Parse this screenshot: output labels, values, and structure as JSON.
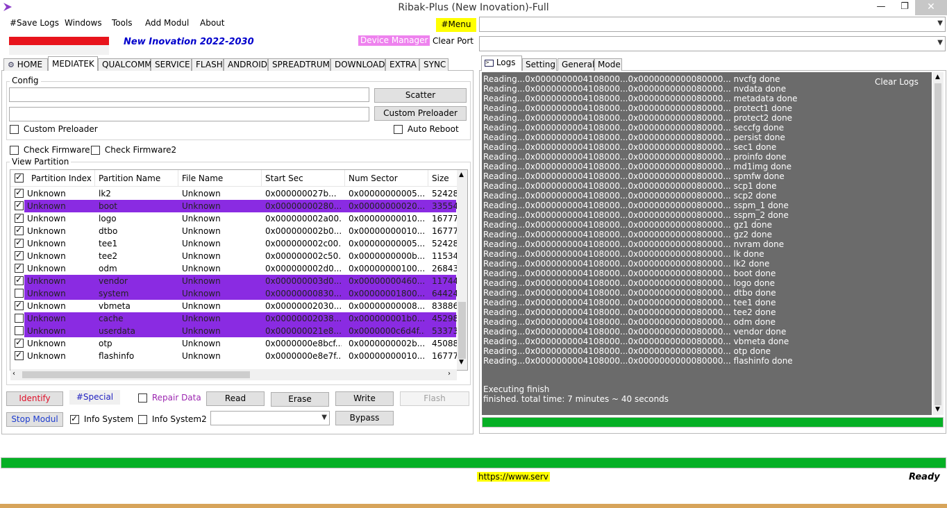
{
  "window": {
    "title": "Ribak-Plus (New Inovation)-Full",
    "controls": {
      "minimize": "—",
      "maximize": "❐",
      "close": "✕"
    }
  },
  "menu": {
    "items": [
      "#Save Logs",
      "Windows",
      "Tools",
      "Add Modul",
      "About"
    ],
    "menu_button": "#Menu"
  },
  "header": {
    "subtitle": "New Inovation 2022-2030",
    "device_manager": "Device Manager",
    "clear_port": "Clear Port",
    "brand_color": "#0000cc"
  },
  "left_tabs": [
    "HOME",
    "MEDIATEK",
    "QUALCOMM",
    "SERVICE",
    "FLASH",
    "ANDROID",
    "SPREADTRUM",
    "DOWNLOAD",
    "EXTRA",
    "SYNC"
  ],
  "config": {
    "label": "Config",
    "scatter_button": "Scatter",
    "custom_preloader_button": "Custom Preloader",
    "custom_preloader_check": "Custom Preloader",
    "auto_reboot": "Auto Reboot",
    "scatter_value": "",
    "preloader_value": ""
  },
  "checks": {
    "check_firmware": "Check Firmware",
    "check_firmware2": "Check Firmware2"
  },
  "partition": {
    "label": "View Partition",
    "columns": [
      "Partition Index",
      "Partition Name",
      "File Name",
      "Start Sec",
      "Num Sector",
      "Size"
    ],
    "rows": [
      {
        "checked": true,
        "selected": false,
        "index": "Unknown",
        "name": "lk2",
        "file": "Unknown",
        "start": "0x000000027b...",
        "num": "0x00000000005...",
        "size": "52428"
      },
      {
        "checked": true,
        "selected": true,
        "index": "Unknown",
        "name": "boot",
        "file": "Unknown",
        "start": "0x00000000280...",
        "num": "0x00000000020...",
        "size": "33554"
      },
      {
        "checked": true,
        "selected": false,
        "index": "Unknown",
        "name": "logo",
        "file": "Unknown",
        "start": "0x000000002a00...",
        "num": "0x00000000010...",
        "size": "16777"
      },
      {
        "checked": true,
        "selected": false,
        "index": "Unknown",
        "name": "dtbo",
        "file": "Unknown",
        "start": "0x000000002b0...",
        "num": "0x00000000010...",
        "size": "16777"
      },
      {
        "checked": true,
        "selected": false,
        "index": "Unknown",
        "name": "tee1",
        "file": "Unknown",
        "start": "0x000000002c00...",
        "num": "0x00000000005...",
        "size": "52428"
      },
      {
        "checked": true,
        "selected": false,
        "index": "Unknown",
        "name": "tee2",
        "file": "Unknown",
        "start": "0x000000002c50...",
        "num": "0x0000000000b...",
        "size": "11534"
      },
      {
        "checked": true,
        "selected": false,
        "index": "Unknown",
        "name": "odm",
        "file": "Unknown",
        "start": "0x000000002d0...",
        "num": "0x00000000100...",
        "size": "26843"
      },
      {
        "checked": true,
        "selected": true,
        "index": "Unknown",
        "name": "vendor",
        "file": "Unknown",
        "start": "0x000000003d0...",
        "num": "0x00000000460...",
        "size": "11744"
      },
      {
        "checked": false,
        "selected": true,
        "index": "Unknown",
        "name": "system",
        "file": "Unknown",
        "start": "0x00000000830...",
        "num": "0x00000001800...",
        "size": "64424"
      },
      {
        "checked": true,
        "selected": false,
        "index": "Unknown",
        "name": "vbmeta",
        "file": "Unknown",
        "start": "0x00000002030...",
        "num": "0x00000000008...",
        "size": "83886"
      },
      {
        "checked": false,
        "selected": true,
        "index": "Unknown",
        "name": "cache",
        "file": "Unknown",
        "start": "0x00000002038...",
        "num": "0x000000001b0...",
        "size": "45298"
      },
      {
        "checked": false,
        "selected": true,
        "index": "Unknown",
        "name": "userdata",
        "file": "Unknown",
        "start": "0x000000021e8...",
        "num": "0x0000000c6d4f...",
        "size": "53373"
      },
      {
        "checked": true,
        "selected": false,
        "index": "Unknown",
        "name": "otp",
        "file": "Unknown",
        "start": "0x0000000e8bcf...",
        "num": "0x0000000002b...",
        "size": "45088"
      },
      {
        "checked": true,
        "selected": false,
        "index": "Unknown",
        "name": "flashinfo",
        "file": "Unknown",
        "start": "0x0000000e8e7f...",
        "num": "0x00000000010...",
        "size": "16777"
      }
    ]
  },
  "actions": {
    "identify": "Identify",
    "special": "#Special",
    "repair_data": "Repair Data",
    "read": "Read",
    "erase": "Erase",
    "write": "Write",
    "flash": "Flash",
    "stop_modul": "Stop Modul",
    "info_system": "Info System",
    "info_system2": "Info System2",
    "bypass": "Bypass",
    "dropdown_value": ""
  },
  "right_tabs": [
    "Logs",
    "Setting",
    "General",
    "Mode"
  ],
  "logs": {
    "clear": "Clear Logs",
    "prefix": "Reading...0x0000000004108000...0x0000000000080000... ",
    "entries": [
      "nvcfg  done",
      "nvdata  done",
      "metadata  done",
      "protect1  done",
      "protect2  done",
      "seccfg  done",
      "persist  done",
      "sec1  done",
      "proinfo  done",
      "md1img  done",
      "spmfw  done",
      "scp1  done",
      "scp2  done",
      "sspm_1  done",
      "sspm_2  done",
      "gz1  done",
      "gz2  done",
      "nvram  done",
      "lk  done",
      "lk2  done",
      "boot  done",
      "logo  done",
      "dtbo  done",
      "tee1  done",
      "tee2  done",
      "odm  done",
      "vendor  done",
      "vbmeta  done",
      "otp  done",
      "flashinfo  done"
    ],
    "finish1": "Executing finish",
    "finish2": "finished. total time: 7 minutes ~ 40 seconds"
  },
  "progress": {
    "logs_progress": 1.0,
    "main_progress": 1.0,
    "color": "#06b025"
  },
  "status": {
    "url": "https://www.serv",
    "state": "Ready"
  }
}
